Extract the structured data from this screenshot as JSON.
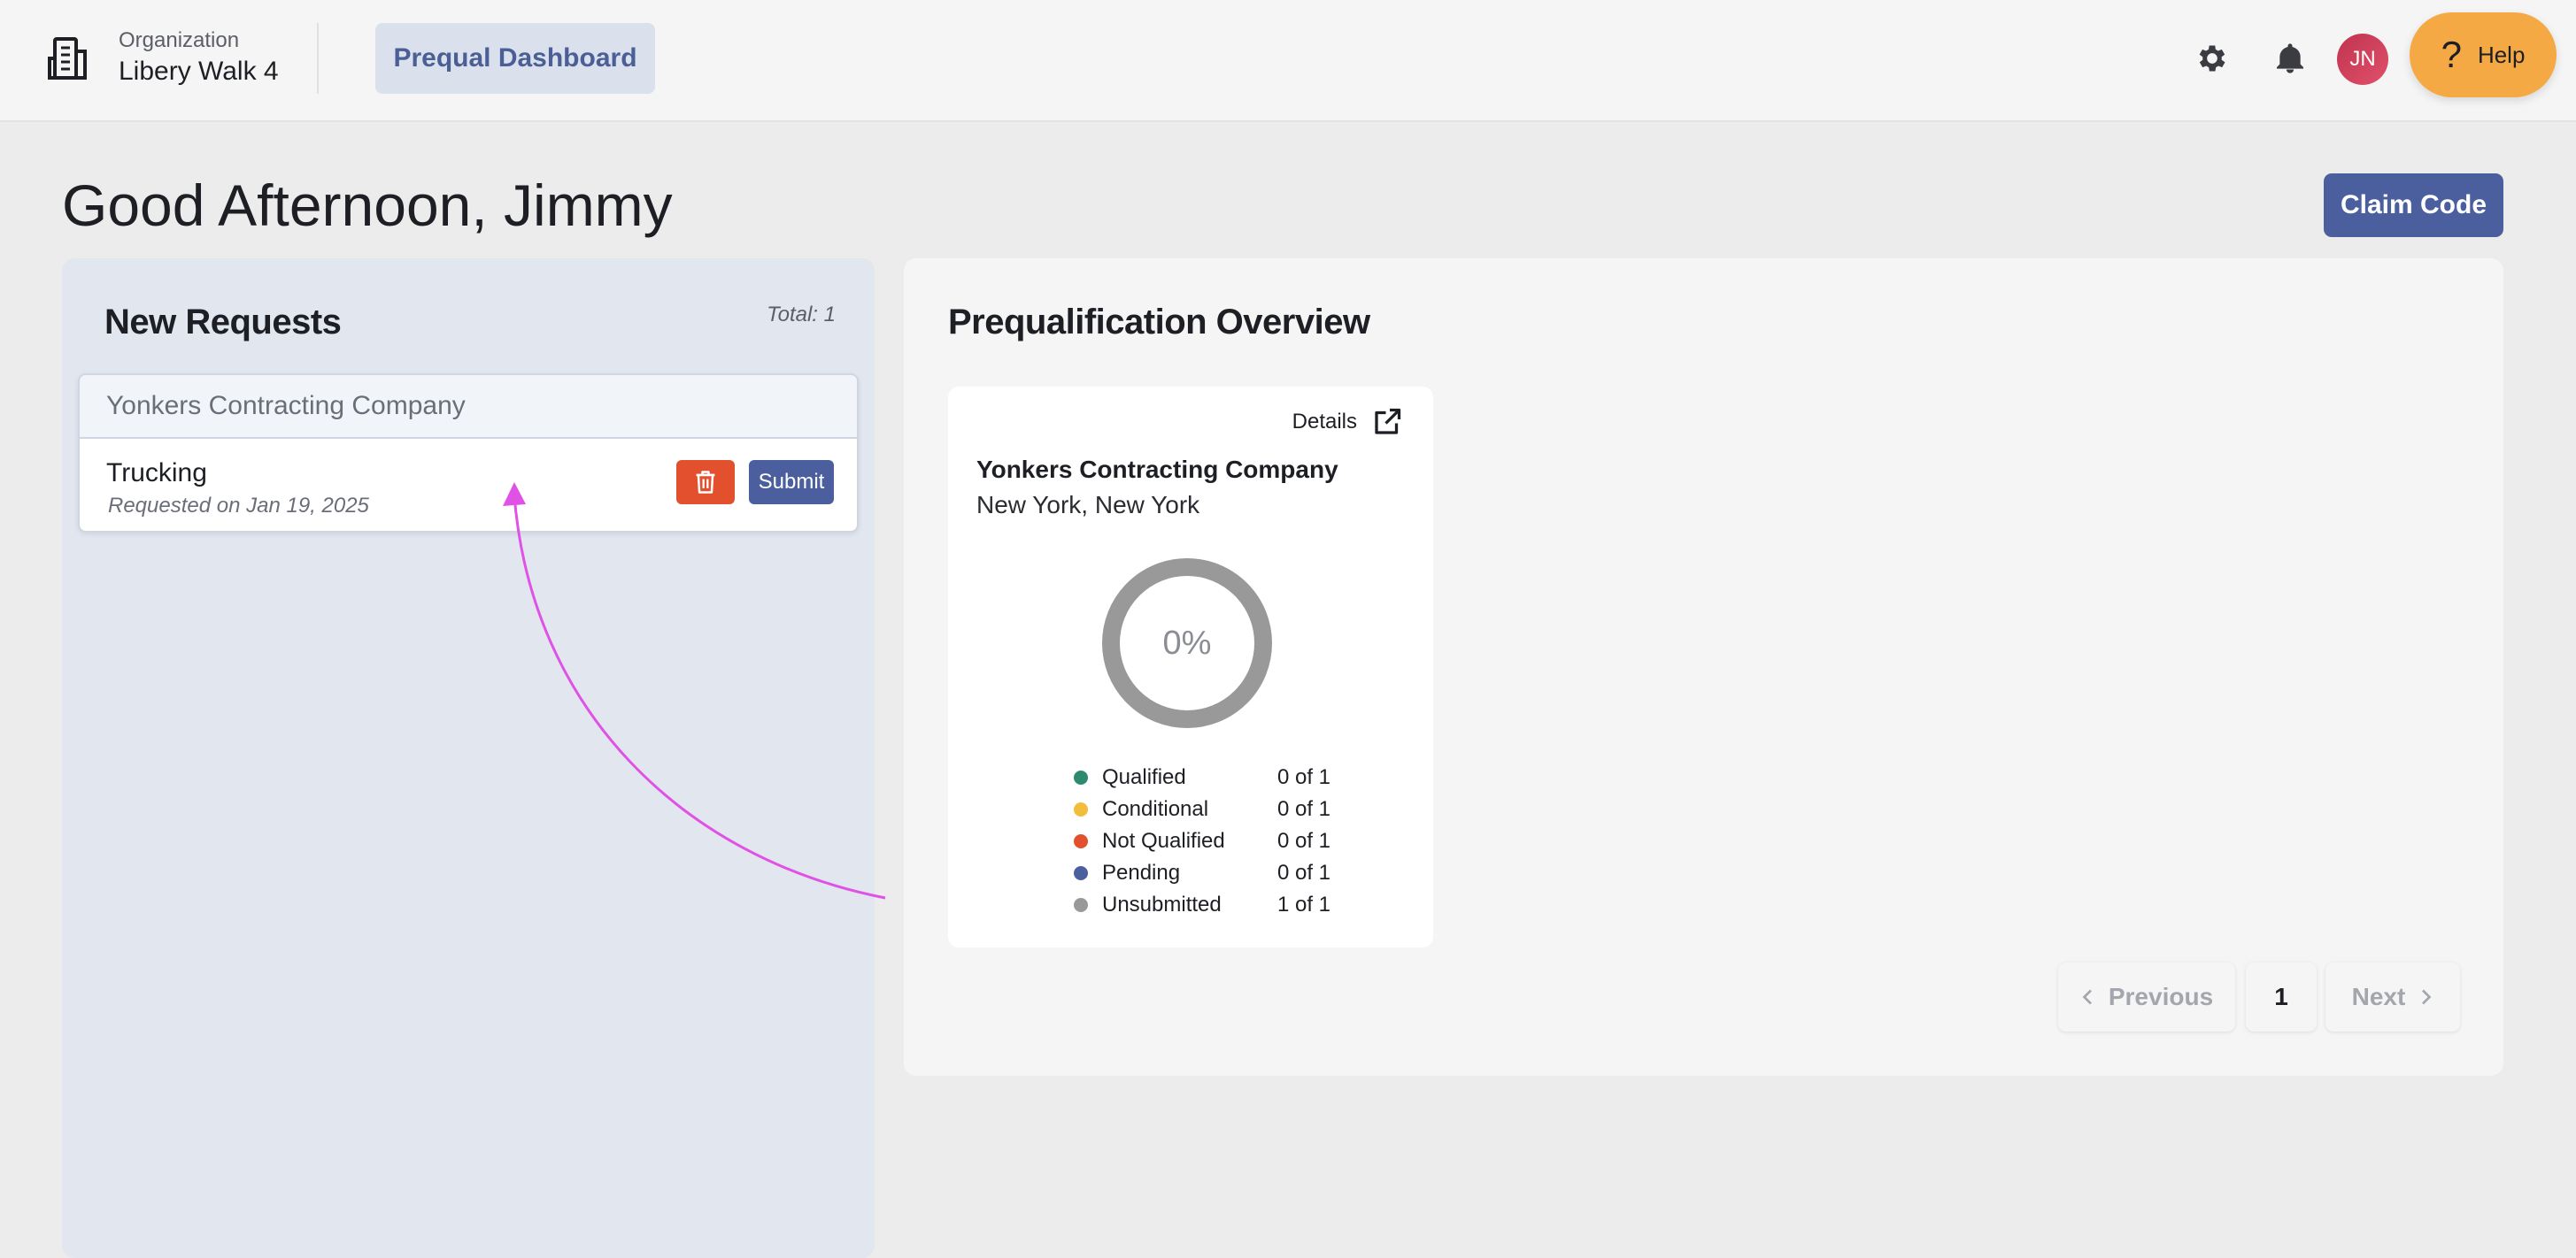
{
  "nav": {
    "org_caption": "Organization",
    "org_name": "Libery Walk 4",
    "tab_label": "Prequal Dashboard",
    "avatar_initials": "JN",
    "help_label": "Help"
  },
  "greeting": "Good Afternoon, Jimmy",
  "claim_code_label": "Claim Code",
  "new_requests": {
    "title": "New Requests",
    "total": "Total: 1",
    "items": [
      {
        "company": "Yonkers Contracting Company",
        "name": "Trucking",
        "requested": "Requested on Jan 19, 2025",
        "submit_label": "Submit"
      }
    ]
  },
  "overview": {
    "title": "Prequalification Overview",
    "details_label": "Details",
    "card": {
      "company": "Yonkers Contracting Company",
      "location": "New York, New York",
      "percent": "0%",
      "legend": [
        {
          "label": "Qualified",
          "count": "0 of 1",
          "color": "#2e8a6e"
        },
        {
          "label": "Conditional",
          "count": "0 of 1",
          "color": "#f2bd3b"
        },
        {
          "label": "Not Qualified",
          "count": "0 of 1",
          "color": "#e2502e"
        },
        {
          "label": "Pending",
          "count": "0 of 1",
          "color": "#4b5f9e"
        },
        {
          "label": "Unsubmitted",
          "count": "1 of 1",
          "color": "#999999"
        }
      ]
    }
  },
  "pagination": {
    "previous_label": "Previous",
    "current_page": "1",
    "next_label": "Next"
  },
  "colors": {
    "accent": "#4b5f9e",
    "help": "#f5a944",
    "delete": "#e2502e",
    "annotation": "#e052e6"
  }
}
